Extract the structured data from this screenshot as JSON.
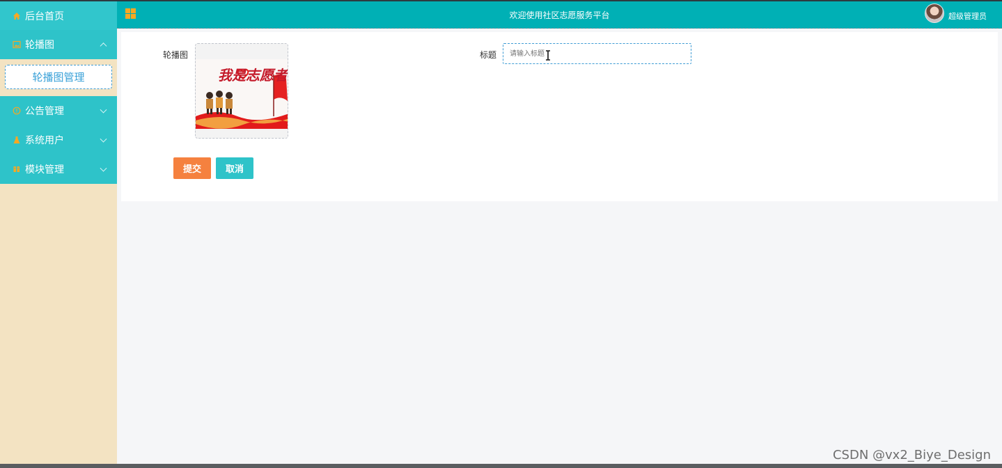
{
  "header": {
    "title": "欢迎使用社区志愿服务平台",
    "admin_name": "超级管理员"
  },
  "sidebar": {
    "items": [
      {
        "label": "后台首页",
        "icon": "home-icon",
        "icon_color": "#f7a823"
      },
      {
        "label": "轮播图",
        "icon": "image-icon",
        "icon_color": "#f7a823",
        "expanded": true
      },
      {
        "label": "公告管理",
        "icon": "info-circle-icon",
        "icon_color": "#f7a823"
      },
      {
        "label": "系统用户",
        "icon": "user-icon",
        "icon_color": "#f7a823"
      },
      {
        "label": "模块管理",
        "icon": "module-icon",
        "icon_color": "#f7a823"
      }
    ],
    "submenu": {
      "label": "轮播图管理"
    }
  },
  "form": {
    "carousel_label": "轮播图",
    "carousel_image_text": "我是志愿者",
    "title_label": "标题",
    "title_placeholder": "请输入标题",
    "submit_label": "提交",
    "cancel_label": "取消"
  },
  "watermark": "CSDN @vx2_Biye_Design",
  "colors": {
    "header_bg": "#00b0b5",
    "menu_bg": "#2ec3c9",
    "sidebar_bg": "#f3e3c2",
    "submit_bg": "#f5813f",
    "cancel_bg": "#2ec3c9"
  }
}
